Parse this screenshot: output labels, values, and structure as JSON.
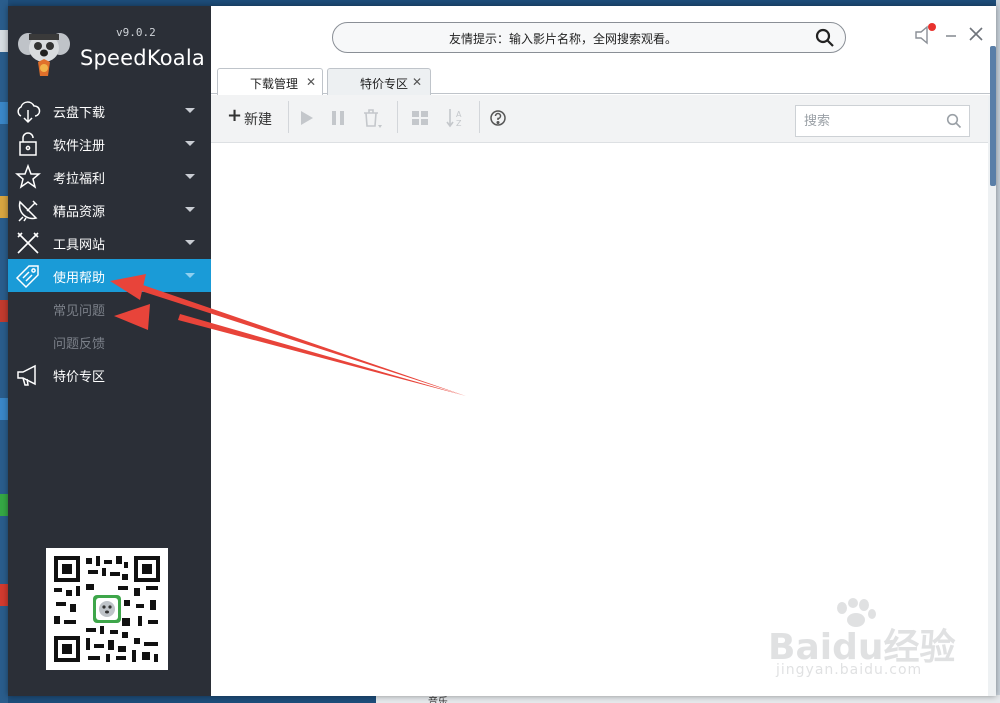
{
  "app": {
    "name": "SpeedKoala",
    "version": "v9.0.2"
  },
  "sidebar": {
    "items": [
      {
        "label": "云盘下载",
        "icon": "cloud-download-icon"
      },
      {
        "label": "软件注册",
        "icon": "lock-icon"
      },
      {
        "label": "考拉福利",
        "icon": "star-icon"
      },
      {
        "label": "精品资源",
        "icon": "satellite-icon"
      },
      {
        "label": "工具网站",
        "icon": "tools-icon"
      },
      {
        "label": "使用帮助",
        "icon": "tag-icon",
        "active": true
      }
    ],
    "subitems": [
      {
        "label": "常见问题"
      },
      {
        "label": "问题反馈"
      }
    ],
    "bottom_item": {
      "label": "特价专区",
      "icon": "megaphone-icon"
    }
  },
  "header": {
    "search_hint": "友情提示：输入影片名称，全网搜索观看。"
  },
  "tabs": [
    {
      "label": "下载管理",
      "active": true
    },
    {
      "label": "特价专区",
      "active": false
    }
  ],
  "toolbar": {
    "new_label": "新建",
    "search_placeholder": "搜索"
  },
  "desktop": {
    "taskbar_text": "音乐"
  },
  "watermark": {
    "brand": "Baidu经验",
    "url": "jingyan.baidu.com"
  },
  "colors": {
    "sidebar_bg": "#2b2f37",
    "active_item": "#1a9bd7",
    "annotation_arrow": "#e8443a"
  }
}
